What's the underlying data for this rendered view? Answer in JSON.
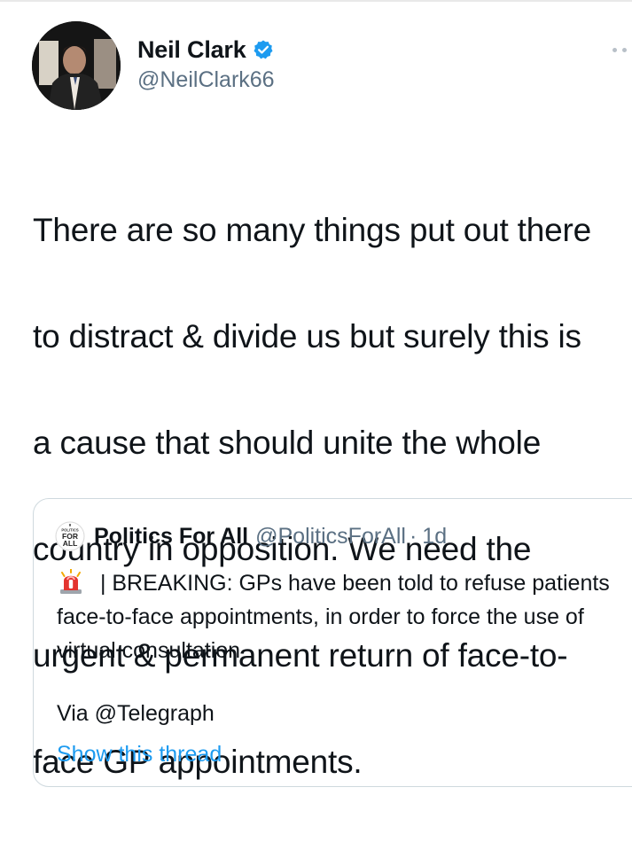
{
  "tweet": {
    "author_name": "Neil Clark",
    "author_handle": "@NeilClark66",
    "verified": true,
    "text_lines": [
      "There are so many things put out there",
      "to distract & divide us but surely this is",
      "a cause that should unite the whole",
      "country in opposition. We need the",
      "urgent & permanent return of face-to-",
      "face GP appointments."
    ]
  },
  "quote": {
    "author_name": "Politics For All",
    "author_handle": "@PoliticsForAll",
    "separator": "·",
    "time": "1d",
    "avatar_text": [
      "POLITICS",
      "FOR",
      "ALL"
    ],
    "icon": "rotating-light-icon",
    "text": " | BREAKING: GPs have been told to refuse patients face-to-face appointments, in order to force the use of virtual consultation",
    "via": "Via @Telegraph",
    "show_thread": "Show this thread"
  },
  "colors": {
    "text": "#0f1419",
    "secondary": "#5b7083",
    "link": "#1d9bf0",
    "border": "#cfd9de",
    "verified": "#1d9bf0"
  },
  "icons": {
    "more": "more-icon",
    "verified": "verified-badge-icon"
  }
}
